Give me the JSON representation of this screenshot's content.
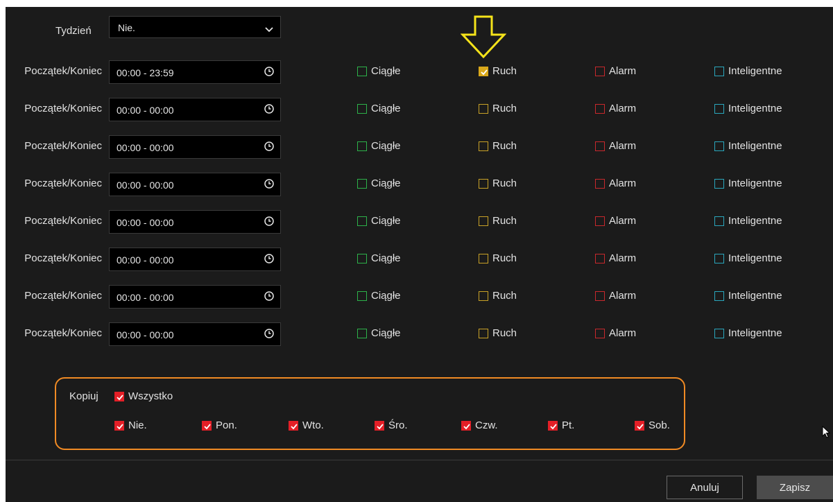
{
  "week": {
    "label": "Tydzień",
    "selected": "Nie."
  },
  "rows": [
    {
      "label": "Początek/Koniec",
      "time": "00:00 - 23:59",
      "continuous": false,
      "motion": true,
      "alarm": false,
      "smart": false
    },
    {
      "label": "Początek/Koniec",
      "time": "00:00 - 00:00",
      "continuous": false,
      "motion": false,
      "alarm": false,
      "smart": false
    },
    {
      "label": "Początek/Koniec",
      "time": "00:00 - 00:00",
      "continuous": false,
      "motion": false,
      "alarm": false,
      "smart": false
    },
    {
      "label": "Początek/Koniec",
      "time": "00:00 - 00:00",
      "continuous": false,
      "motion": false,
      "alarm": false,
      "smart": false
    },
    {
      "label": "Początek/Koniec",
      "time": "00:00 - 00:00",
      "continuous": false,
      "motion": false,
      "alarm": false,
      "smart": false
    },
    {
      "label": "Początek/Koniec",
      "time": "00:00 - 00:00",
      "continuous": false,
      "motion": false,
      "alarm": false,
      "smart": false
    },
    {
      "label": "Początek/Koniec",
      "time": "00:00 - 00:00",
      "continuous": false,
      "motion": false,
      "alarm": false,
      "smart": false
    },
    {
      "label": "Początek/Koniec",
      "time": "00:00 - 00:00",
      "continuous": false,
      "motion": false,
      "alarm": false,
      "smart": false
    }
  ],
  "types": {
    "continuous": "Ciągłe",
    "motion": "Ruch",
    "alarm": "Alarm",
    "smart": "Inteligentne"
  },
  "copy": {
    "label": "Kopiuj",
    "all": "Wszystko",
    "days": [
      "Nie.",
      "Pon.",
      "Wto.",
      "Śro.",
      "Czw.",
      "Pt.",
      "Sob."
    ],
    "all_checked": true,
    "days_checked": [
      true,
      true,
      true,
      true,
      true,
      true,
      true
    ]
  },
  "buttons": {
    "cancel": "Anuluj",
    "save": "Zapisz"
  },
  "colors": {
    "continuous": "#2db24a",
    "motion": "#c9a227",
    "alarm": "#c8282c",
    "smart": "#2aa7bd",
    "highlight_arrow": "#f5e31a",
    "highlight_outline": "#f08a24",
    "copy_check": "#e41f27"
  },
  "icons": {
    "dropdown": "chevron-down-icon",
    "time": "clock-icon",
    "annotation": "down-arrow-icon",
    "pointer": "mouse-cursor-icon"
  }
}
